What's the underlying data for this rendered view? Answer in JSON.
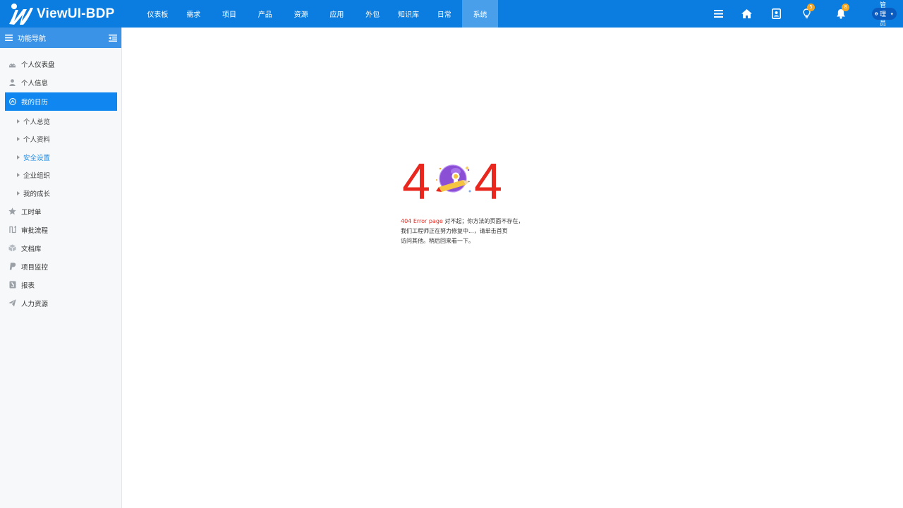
{
  "app": {
    "logo_text": "ViewUI-BDP"
  },
  "nav": {
    "items": [
      "仪表板",
      "需求",
      "项目",
      "产品",
      "资源",
      "应用",
      "外包",
      "知识库",
      "日常",
      "系统"
    ],
    "active_index": 9
  },
  "header_icons": {
    "bulb_badge": "5",
    "bell_badge": "8",
    "user_label": "管理员"
  },
  "sidebar": {
    "title": "功能导航",
    "items": [
      {
        "label": "个人仪表盘",
        "icon": "dashboard-icon"
      },
      {
        "label": "个人信息",
        "icon": "user-icon"
      },
      {
        "label": "我的日历",
        "icon": "calendar-icon",
        "active": true
      },
      {
        "label": "工时单",
        "icon": "star-icon"
      },
      {
        "label": "审批流程",
        "icon": "flow-icon"
      },
      {
        "label": "文档库",
        "icon": "cube-icon"
      },
      {
        "label": "项目监控",
        "icon": "paypal-icon"
      },
      {
        "label": "报表",
        "icon": "report-icon"
      },
      {
        "label": "人力资源",
        "icon": "paper-plane-icon"
      }
    ],
    "subitems": [
      {
        "label": "个人总览"
      },
      {
        "label": "个人资料"
      },
      {
        "label": "安全设置",
        "selected": true
      },
      {
        "label": "企业组织"
      },
      {
        "label": "我的成长"
      }
    ]
  },
  "error": {
    "digit_left": "4",
    "digit_right": "4",
    "title": "404 Error page",
    "line1_rest": " 对不起；你方法的页面不存在，",
    "line2": "我们工程师正在努力修复中...，请单击首页",
    "line3": "访问其他。稍后回来看一下。"
  },
  "colors": {
    "topbar": "#0b7de0",
    "nav_active": "#4a9fea",
    "sidebar_head": "#3a93e6",
    "menu_active": "#0f86f0",
    "error_red": "#e8281f",
    "badge": "#f5a623"
  }
}
